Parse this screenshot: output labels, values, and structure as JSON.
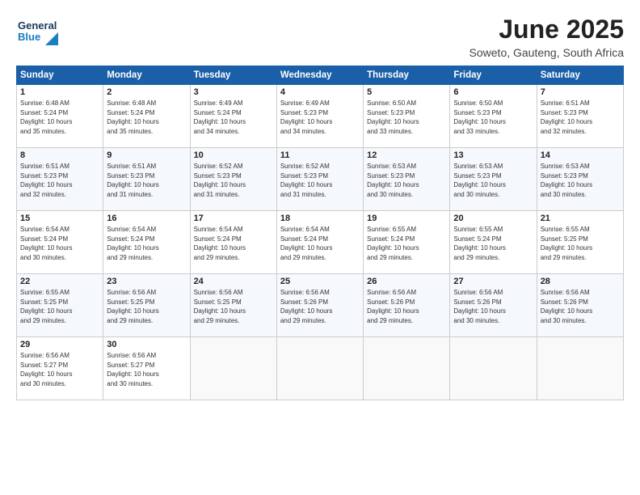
{
  "logo": {
    "line1": "General",
    "line2": "Blue"
  },
  "title": "June 2025",
  "location": "Soweto, Gauteng, South Africa",
  "days_header": [
    "Sunday",
    "Monday",
    "Tuesday",
    "Wednesday",
    "Thursday",
    "Friday",
    "Saturday"
  ],
  "weeks": [
    [
      {
        "day": "1",
        "info": "Sunrise: 6:48 AM\nSunset: 5:24 PM\nDaylight: 10 hours\nand 35 minutes."
      },
      {
        "day": "2",
        "info": "Sunrise: 6:48 AM\nSunset: 5:24 PM\nDaylight: 10 hours\nand 35 minutes."
      },
      {
        "day": "3",
        "info": "Sunrise: 6:49 AM\nSunset: 5:24 PM\nDaylight: 10 hours\nand 34 minutes."
      },
      {
        "day": "4",
        "info": "Sunrise: 6:49 AM\nSunset: 5:23 PM\nDaylight: 10 hours\nand 34 minutes."
      },
      {
        "day": "5",
        "info": "Sunrise: 6:50 AM\nSunset: 5:23 PM\nDaylight: 10 hours\nand 33 minutes."
      },
      {
        "day": "6",
        "info": "Sunrise: 6:50 AM\nSunset: 5:23 PM\nDaylight: 10 hours\nand 33 minutes."
      },
      {
        "day": "7",
        "info": "Sunrise: 6:51 AM\nSunset: 5:23 PM\nDaylight: 10 hours\nand 32 minutes."
      }
    ],
    [
      {
        "day": "8",
        "info": "Sunrise: 6:51 AM\nSunset: 5:23 PM\nDaylight: 10 hours\nand 32 minutes."
      },
      {
        "day": "9",
        "info": "Sunrise: 6:51 AM\nSunset: 5:23 PM\nDaylight: 10 hours\nand 31 minutes."
      },
      {
        "day": "10",
        "info": "Sunrise: 6:52 AM\nSunset: 5:23 PM\nDaylight: 10 hours\nand 31 minutes."
      },
      {
        "day": "11",
        "info": "Sunrise: 6:52 AM\nSunset: 5:23 PM\nDaylight: 10 hours\nand 31 minutes."
      },
      {
        "day": "12",
        "info": "Sunrise: 6:53 AM\nSunset: 5:23 PM\nDaylight: 10 hours\nand 30 minutes."
      },
      {
        "day": "13",
        "info": "Sunrise: 6:53 AM\nSunset: 5:23 PM\nDaylight: 10 hours\nand 30 minutes."
      },
      {
        "day": "14",
        "info": "Sunrise: 6:53 AM\nSunset: 5:23 PM\nDaylight: 10 hours\nand 30 minutes."
      }
    ],
    [
      {
        "day": "15",
        "info": "Sunrise: 6:54 AM\nSunset: 5:24 PM\nDaylight: 10 hours\nand 30 minutes."
      },
      {
        "day": "16",
        "info": "Sunrise: 6:54 AM\nSunset: 5:24 PM\nDaylight: 10 hours\nand 29 minutes."
      },
      {
        "day": "17",
        "info": "Sunrise: 6:54 AM\nSunset: 5:24 PM\nDaylight: 10 hours\nand 29 minutes."
      },
      {
        "day": "18",
        "info": "Sunrise: 6:54 AM\nSunset: 5:24 PM\nDaylight: 10 hours\nand 29 minutes."
      },
      {
        "day": "19",
        "info": "Sunrise: 6:55 AM\nSunset: 5:24 PM\nDaylight: 10 hours\nand 29 minutes."
      },
      {
        "day": "20",
        "info": "Sunrise: 6:55 AM\nSunset: 5:24 PM\nDaylight: 10 hours\nand 29 minutes."
      },
      {
        "day": "21",
        "info": "Sunrise: 6:55 AM\nSunset: 5:25 PM\nDaylight: 10 hours\nand 29 minutes."
      }
    ],
    [
      {
        "day": "22",
        "info": "Sunrise: 6:55 AM\nSunset: 5:25 PM\nDaylight: 10 hours\nand 29 minutes."
      },
      {
        "day": "23",
        "info": "Sunrise: 6:56 AM\nSunset: 5:25 PM\nDaylight: 10 hours\nand 29 minutes."
      },
      {
        "day": "24",
        "info": "Sunrise: 6:56 AM\nSunset: 5:25 PM\nDaylight: 10 hours\nand 29 minutes."
      },
      {
        "day": "25",
        "info": "Sunrise: 6:56 AM\nSunset: 5:26 PM\nDaylight: 10 hours\nand 29 minutes."
      },
      {
        "day": "26",
        "info": "Sunrise: 6:56 AM\nSunset: 5:26 PM\nDaylight: 10 hours\nand 29 minutes."
      },
      {
        "day": "27",
        "info": "Sunrise: 6:56 AM\nSunset: 5:26 PM\nDaylight: 10 hours\nand 30 minutes."
      },
      {
        "day": "28",
        "info": "Sunrise: 6:56 AM\nSunset: 5:26 PM\nDaylight: 10 hours\nand 30 minutes."
      }
    ],
    [
      {
        "day": "29",
        "info": "Sunrise: 6:56 AM\nSunset: 5:27 PM\nDaylight: 10 hours\nand 30 minutes."
      },
      {
        "day": "30",
        "info": "Sunrise: 6:56 AM\nSunset: 5:27 PM\nDaylight: 10 hours\nand 30 minutes."
      },
      {
        "day": "",
        "info": ""
      },
      {
        "day": "",
        "info": ""
      },
      {
        "day": "",
        "info": ""
      },
      {
        "day": "",
        "info": ""
      },
      {
        "day": "",
        "info": ""
      }
    ]
  ]
}
